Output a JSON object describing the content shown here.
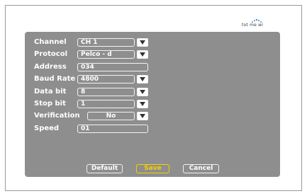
{
  "brand": {
    "logo_text": "tot me wi"
  },
  "fields": [
    {
      "label": "Channel",
      "value": "CH 1",
      "type": "select"
    },
    {
      "label": "Protocol",
      "value": "Pelco - d",
      "type": "select"
    },
    {
      "label": "Address",
      "value": "034",
      "type": "text"
    },
    {
      "label": "Baud Rate",
      "value": "4800",
      "type": "select"
    },
    {
      "label": "Data bit",
      "value": "8",
      "type": "select"
    },
    {
      "label": "Stop bit",
      "value": "1",
      "type": "select"
    },
    {
      "label": "Verification",
      "value": "No",
      "type": "select"
    },
    {
      "label": "Speed",
      "value": "01",
      "type": "text"
    }
  ],
  "buttons": {
    "default_label": "Default",
    "save_label": "Save",
    "cancel_label": "Cancel"
  },
  "colors": {
    "panel": "#8e8e8e",
    "text": "#ffffff",
    "focus": "#f5d000"
  }
}
